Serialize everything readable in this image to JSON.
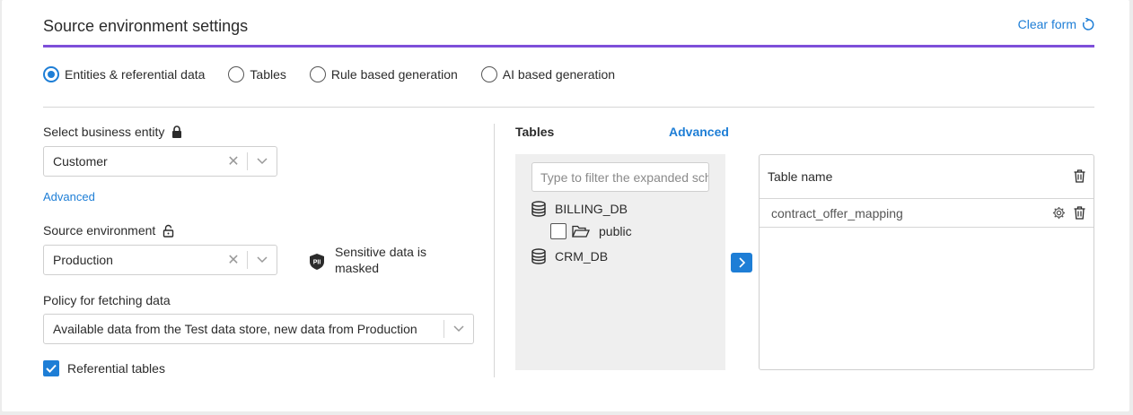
{
  "header": {
    "title": "Source environment settings",
    "clear_label": "Clear form"
  },
  "modes": [
    {
      "label": "Entities & referential data",
      "selected": true
    },
    {
      "label": "Tables",
      "selected": false
    },
    {
      "label": "Rule based generation",
      "selected": false
    },
    {
      "label": "AI based generation",
      "selected": false
    }
  ],
  "business_entity": {
    "label": "Select business entity",
    "value": "Customer",
    "advanced_label": "Advanced"
  },
  "source_env": {
    "label": "Source environment",
    "value": "Production",
    "sensitive_text": "Sensitive data is masked",
    "pii_badge": "PII"
  },
  "policy": {
    "label": "Policy for fetching data",
    "value": "Available data from the Test data store, new data from Production"
  },
  "referential": {
    "label": "Referential tables",
    "checked": true
  },
  "tables": {
    "title": "Tables",
    "advanced_label": "Advanced",
    "filter_placeholder": "Type to filter the expanded schemas",
    "tree": [
      {
        "label": "BILLING_DB",
        "children": [
          {
            "label": "public"
          }
        ]
      },
      {
        "label": "CRM_DB"
      }
    ],
    "selected_header": "Table name",
    "selected_rows": [
      "contract_offer_mapping"
    ]
  },
  "colors": {
    "accent": "#1e7ed6",
    "header_underline": "#7e4fd9"
  }
}
